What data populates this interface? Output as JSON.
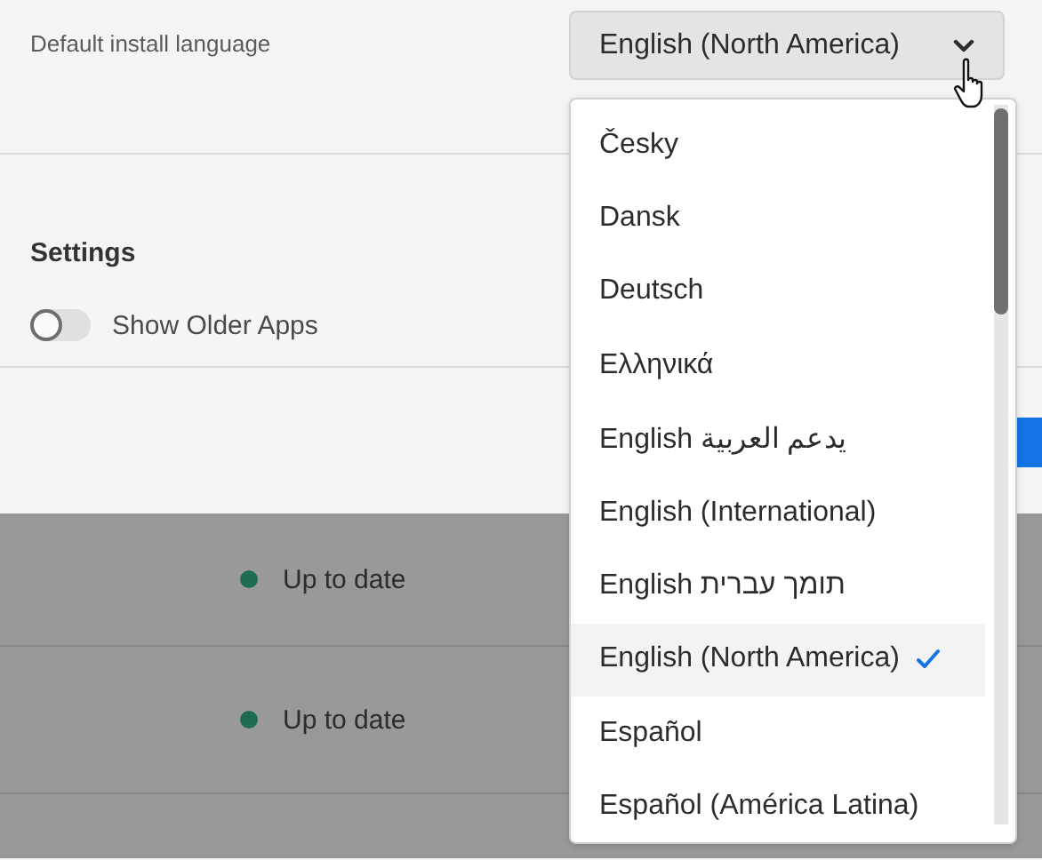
{
  "language_setting": {
    "label": "Default install language",
    "value": "English (North America)",
    "open": true
  },
  "settings": {
    "title": "Settings",
    "toggles": [
      {
        "label": "Show Older Apps",
        "on": false
      }
    ]
  },
  "apps": [
    {
      "status": "Up to date"
    },
    {
      "status": "Up to date"
    }
  ],
  "menu": {
    "items": [
      {
        "label": "Česky",
        "selected": false
      },
      {
        "label": "Dansk",
        "selected": false
      },
      {
        "label": "Deutsch",
        "selected": false
      },
      {
        "label": "Ελληνικά",
        "selected": false
      },
      {
        "label": "English يدعم العربية",
        "selected": false
      },
      {
        "label": "English (International)",
        "selected": false
      },
      {
        "label": "English תומך עברית",
        "selected": false
      },
      {
        "label": "English (North America)",
        "selected": true
      },
      {
        "label": "Español",
        "selected": false
      },
      {
        "label": "Español (América Latina)",
        "selected": false
      }
    ]
  }
}
